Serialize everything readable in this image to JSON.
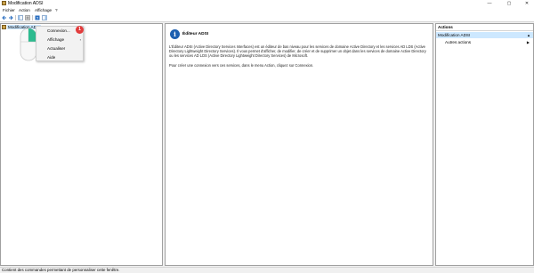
{
  "window": {
    "title": "Modification ADSI",
    "minimize": "—",
    "maximize": "▢",
    "close": "✕"
  },
  "menu": {
    "items": [
      "Fichier",
      "Action",
      "Affichage",
      "?"
    ]
  },
  "toolbar": {
    "icons": [
      "back-arrow-icon",
      "forward-arrow-icon",
      "show-hide-tree-icon",
      "properties-icon",
      "help-icon",
      "action-pane-icon"
    ]
  },
  "tree": {
    "root_label": "Modification ADSI"
  },
  "context_menu": {
    "items": [
      {
        "label": "Connexion...",
        "has_submenu": false
      },
      {
        "label": "Affichage",
        "has_submenu": true
      },
      {
        "label": "Actualiser",
        "has_submenu": false
      },
      {
        "label": "Aide",
        "has_submenu": false
      }
    ],
    "submenu_arrow": "›",
    "badge": "1"
  },
  "center": {
    "info_glyph": "i",
    "title": "Éditeur ADSI",
    "description": "L'Éditeur ADSI (Active Directory Services Interfaces) est un éditeur de bas niveau pour les services de domaine Active Directory et les services AD LDS (Active Directory Lightweight Directory Services). Il vous permet d'afficher, de modifier, de créer et de supprimer un objet dans les services de domaine Active Directory ou les services AD LDS (Active Directory Lightweight Directory Services) de Microsoft.",
    "instruction": "Pour créer une connexion vers ces services, dans le menu Action, cliquez sur Connexion."
  },
  "actions": {
    "header": "Actions",
    "section_label": "Modification ADSI",
    "section_arrow": "▲",
    "more_label": "Autres actions",
    "more_arrow": "▶"
  },
  "status": {
    "text": "Contient des commandes permettant de personnaliser cette fenêtre."
  },
  "colors": {
    "accent": "#1c5fb0",
    "selection": "#cde8ff",
    "badge": "#e23c3c"
  }
}
